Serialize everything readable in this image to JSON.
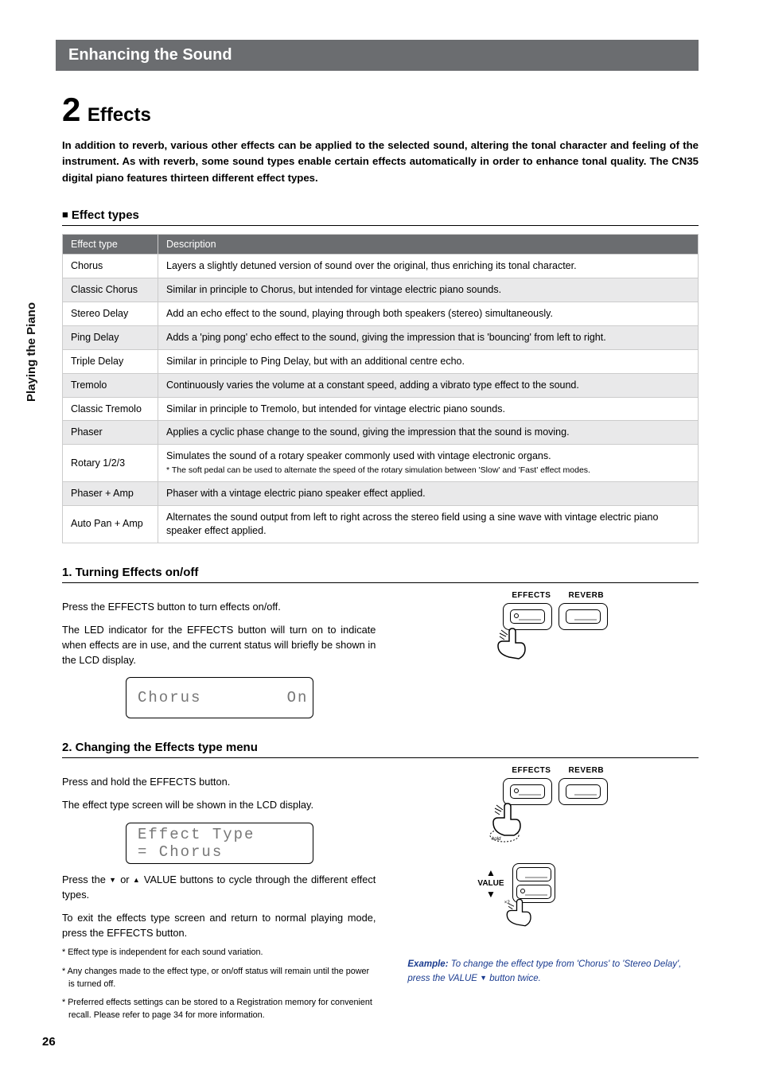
{
  "sidebar_tab": "Playing the Piano",
  "header_bar": "Enhancing the Sound",
  "section_number": "2",
  "section_title": "Effects",
  "intro": "In addition to reverb, various other effects can be applied to the selected sound, altering the tonal character and feeling of the instrument. As with reverb, some sound types enable certain effects automatically in order to enhance tonal quality. The CN35 digital piano features thirteen different effect types.",
  "effect_types_heading": "Effect types",
  "table": {
    "head": {
      "col1": "Effect type",
      "col2": "Description"
    },
    "rows": [
      {
        "name": "Chorus",
        "desc": "Layers a slightly detuned version of sound over the original, thus enriching its tonal character."
      },
      {
        "name": "Classic Chorus",
        "desc": "Similar in principle to Chorus, but intended for vintage electric piano sounds."
      },
      {
        "name": "Stereo Delay",
        "desc": "Add an echo effect to the sound, playing through both speakers (stereo) simultaneously."
      },
      {
        "name": "Ping Delay",
        "desc": "Adds a 'ping pong' echo effect to the sound, giving the impression that is 'bouncing' from left to right."
      },
      {
        "name": "Triple Delay",
        "desc": "Similar in principle to Ping Delay, but with an additional centre echo."
      },
      {
        "name": "Tremolo",
        "desc": "Continuously varies the volume at a constant speed, adding a vibrato type effect to the sound."
      },
      {
        "name": "Classic Tremolo",
        "desc": "Similar in principle to Tremolo, but intended for vintage electric piano sounds."
      },
      {
        "name": "Phaser",
        "desc": "Applies a cyclic phase change to the sound, giving the impression that the sound is moving."
      },
      {
        "name": "Rotary 1/2/3",
        "desc": "Simulates the sound of a rotary speaker commonly used with vintage electronic organs.",
        "note": "* The soft pedal can be used to alternate the speed of the rotary simulation between 'Slow' and 'Fast' effect modes."
      },
      {
        "name": "Phaser + Amp",
        "desc": "Phaser with a vintage electric piano speaker effect applied."
      },
      {
        "name": "Auto Pan + Amp",
        "desc": "Alternates the sound output from left to right across the stereo field using a sine wave with vintage electric piano speaker effect applied."
      }
    ]
  },
  "step1": {
    "heading": "1. Turning Effects on/off",
    "p1": "Press the EFFECTS button to turn effects on/off.",
    "p2": "The LED indicator for the EFFECTS button will turn on to indicate when effects are in use, and the current status will briefly be shown in the LCD display.",
    "lcd": "Chorus        On",
    "btn_effects": "EFFECTS",
    "btn_reverb": "REVERB"
  },
  "step2": {
    "heading": "2. Changing the Effects type menu",
    "p1": "Press and hold the EFFECTS button.",
    "p2": "The effect type screen will be shown in the LCD display.",
    "lcd_line1": "Effect Type",
    "lcd_line2": "= Chorus",
    "p3a": "Press the ",
    "p3b": " or ",
    "p3c": " VALUE buttons to cycle through the different effect types.",
    "p4": "To exit the effects type screen and return to normal playing mode, press the EFFECTS button.",
    "note1": "* Effect type is independent for each sound variation.",
    "note2": "* Any changes made to the effect type, or on/off status will remain until the power is turned off.",
    "note3": "* Preferred effects settings can be stored to a Registration memory for convenient recall. Please refer to page 34 for more information.",
    "btn_effects": "EFFECTS",
    "btn_reverb": "REVERB",
    "value_label": "VALUE",
    "example_prefix": "Example:",
    "example_text_a": " To change the effect type from 'Chorus' to 'Stereo Delay', press the VALUE ",
    "example_text_b": " button twice."
  },
  "page_number": "26"
}
